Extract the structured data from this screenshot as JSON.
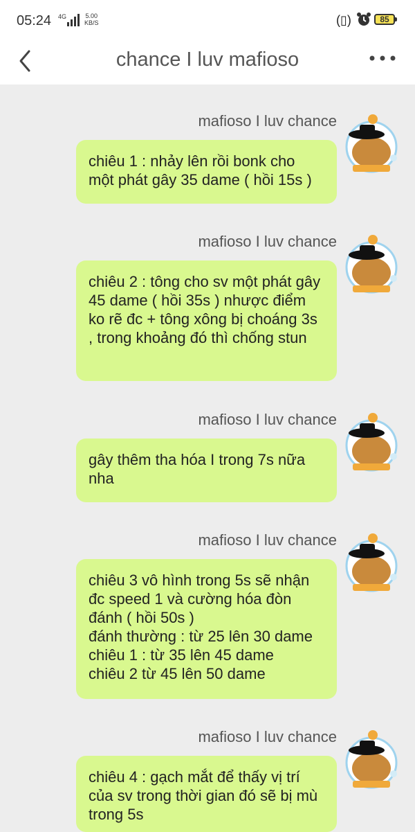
{
  "status_bar": {
    "time": "05:24",
    "network": "4G",
    "speed_value": "5.00",
    "speed_unit": "KB/S",
    "battery": "85"
  },
  "header": {
    "title": "chance I luv mafioso"
  },
  "messages": [
    {
      "sender": "mafioso I luv chance",
      "text": "chiêu 1 : nhảy lên rồi bonk cho một phát gây 35 dame ( hồi 15s )"
    },
    {
      "sender": "mafioso I luv chance",
      "text": "chiêu 2 : tông cho sv một phát gây 45 dame ( hồi 35s ) nhược điểm ko rẽ đc + tông xông bị choáng 3s , trong khoảng đó thì chống stun"
    },
    {
      "sender": "mafioso I luv chance",
      "text": "gây thêm tha hóa I trong 7s nữa nha"
    },
    {
      "sender": "mafioso I luv chance",
      "text": "chiêu 3 vô hình trong 5s sẽ nhận đc speed 1 và cường hóa đòn đánh ( hồi 50s )\nđánh thường : từ 25 lên 30 dame\nchiêu 1 : từ 35 lên 45 dame\nchiêu 2 từ 45 lên 50 dame"
    },
    {
      "sender": "mafioso I luv chance",
      "text": "chiêu 4 : gạch mắt để thấy vị trí của sv trong thời gian đó sẽ bị mù trong 5s"
    }
  ],
  "icons": {
    "back": "chevron-left-icon",
    "more": "more-dots-icon",
    "alarm": "alarm-icon",
    "vibrate": "vibrate-icon",
    "battery": "battery-icon",
    "avatar": "capybara-avatar"
  },
  "colors": {
    "bubble": "#d9f88f",
    "background": "#ededed",
    "header": "#ffffff",
    "battery_fill": "#f6e256"
  }
}
